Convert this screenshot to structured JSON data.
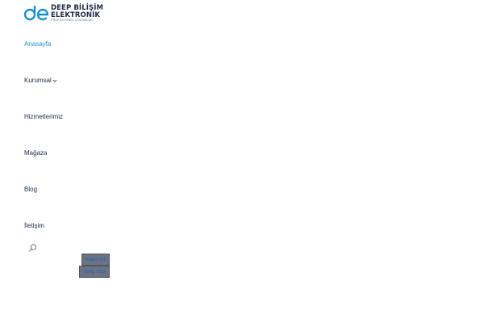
{
  "logo": {
    "line1": "DEEP BİLİŞİM",
    "line2": "ELEKTRONİK",
    "tagline": "PROFESYONEL ÇÖZÜMLER",
    "mark_icon": "de-monogram-logo",
    "mark_color": "#1c8fd1"
  },
  "nav": {
    "items": [
      {
        "label": "Anasayfa",
        "active": true
      },
      {
        "label": "Kurumsal",
        "has_dropdown": true
      },
      {
        "label": "Hizmetlerimiz"
      },
      {
        "label": "Mağaza"
      },
      {
        "label": "Blog"
      },
      {
        "label": "İletişim"
      }
    ],
    "active_color": "#1c8fd1",
    "text_color": "#1f2a44"
  },
  "search": {
    "icon": "search-icon"
  },
  "account": {
    "register_label": "Kayıt Ol",
    "login_label": "Giriş Yap",
    "button_bg": "#6b7381",
    "button_text_color": "#1c5fd1"
  }
}
